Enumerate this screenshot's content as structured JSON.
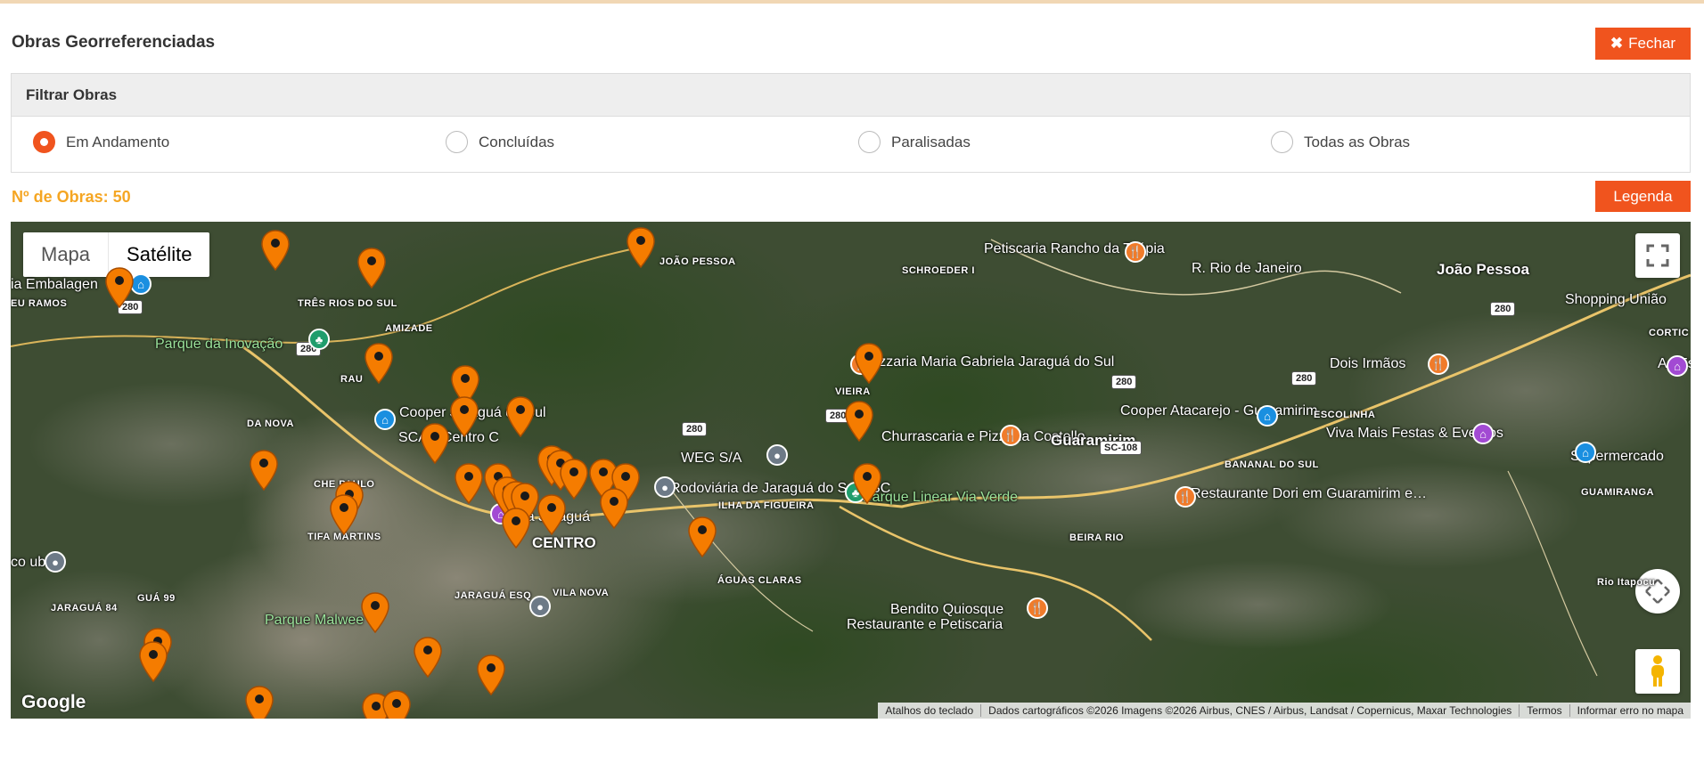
{
  "header": {
    "title": "Obras Georreferenciadas",
    "close_icon": "times-icon",
    "close_label": "Fechar"
  },
  "filter": {
    "heading": "Filtrar Obras",
    "options": [
      {
        "label": "Em Andamento",
        "selected": true
      },
      {
        "label": "Concluídas",
        "selected": false
      },
      {
        "label": "Paralisadas",
        "selected": false
      },
      {
        "label": "Todas as Obras",
        "selected": false
      }
    ]
  },
  "summary": {
    "count_label": "Nº de Obras:",
    "count_value": "50",
    "legend_label": "Legenda"
  },
  "map": {
    "type_options": [
      "Mapa",
      "Satélite"
    ],
    "active_type": "Satélite",
    "colors": {
      "accent": "#f0541e",
      "count": "#f5a623",
      "marker": "#f57c00"
    },
    "place_labels": [
      "Petiscaria Rancho da Tilápia",
      "JOÃO PESSOA",
      "SCHROEDER I",
      "R. Rio de Janeiro",
      "João Pessoa",
      "Shopping União",
      "ia Embalagen",
      "EU RAMOS",
      "TRÊS RIOS DO SUL",
      "AMIZADE",
      "Parque da Inovação",
      "RAU",
      "Pizzaria Maria Gabriela Jaraguá do Sul",
      "VIEIRA",
      "Dois Irmãos",
      "CORTIC",
      "As Es",
      "Cooper Jaraguá do Sul",
      "Cooper Atacarejo - Guaramirim",
      "ESCOLINHA",
      "DA NOVA",
      "Churrascaria e Pizzaria Costello",
      "Guaramirim",
      "Viva Mais Festas & Eventos",
      "Supermercado",
      "SCAR Centro C",
      "CHE PAULO",
      "WEG S/A",
      "BANANAL DO SUL",
      "Rodoviária de Jaraguá do Sul - SC",
      "Parque Linear Via Verde",
      "Restaurante Dori em Guaramirim e…",
      "GUAMIRANGA",
      "Arena Jaraguá",
      "TIFA MARTINS",
      "CENTRO",
      "ILHA DA FIGUEIRA",
      "BEIRA RIO",
      "co ub",
      "ÁGUAS CLARAS",
      "JARAGUÁ 84",
      "GUÁ 99",
      "JARAGUÁ ESQ",
      "VILA NOVA",
      "Parque Malwee",
      "Bendito Quiosque",
      "Restaurante e Petiscaria",
      "Rio Itapocu"
    ],
    "road_shields": [
      "280",
      "280",
      "280",
      "280",
      "280",
      "280",
      "SC-108",
      "280"
    ],
    "controls": {
      "fullscreen_icon": "fullscreen-icon",
      "camera_icon": "camera-move-icon",
      "pegman_icon": "pegman-icon"
    },
    "logo": "Google",
    "attribution": [
      "Atalhos do teclado",
      "Dados cartográficos ©2026 Imagens ©2026 Airbus, CNES / Airbus, Landsat / Copernicus, Maxar Technologies",
      "Termos",
      "Informar erro no mapa"
    ]
  }
}
